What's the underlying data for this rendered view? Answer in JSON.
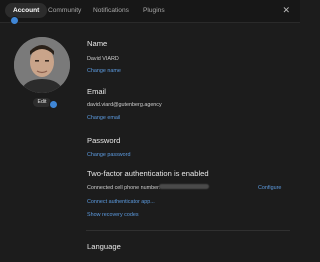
{
  "tabs": [
    {
      "label": "Account",
      "active": true
    },
    {
      "label": "Community",
      "active": false
    },
    {
      "label": "Notifications",
      "active": false
    },
    {
      "label": "Plugins",
      "active": false
    }
  ],
  "close_icon": "close-icon",
  "avatar": {
    "edit_label": "Edit"
  },
  "name": {
    "title": "Name",
    "value": "David VIARD",
    "action": "Change name"
  },
  "email": {
    "title": "Email",
    "value": "david.viard@gutenberg.agency",
    "action": "Change email"
  },
  "password": {
    "title": "Password",
    "action": "Change password"
  },
  "two_factor": {
    "title": "Two-factor authentication is enabled",
    "phone_label": "Connected cell phone number:",
    "configure_label": "Configure",
    "connect_app_label": "Connect authenticator app...",
    "recovery_label": "Show recovery codes"
  },
  "language": {
    "title": "Language"
  },
  "colors": {
    "accent": "#3f86d6",
    "link": "#5c9be0",
    "background": "#1c1c1c"
  }
}
